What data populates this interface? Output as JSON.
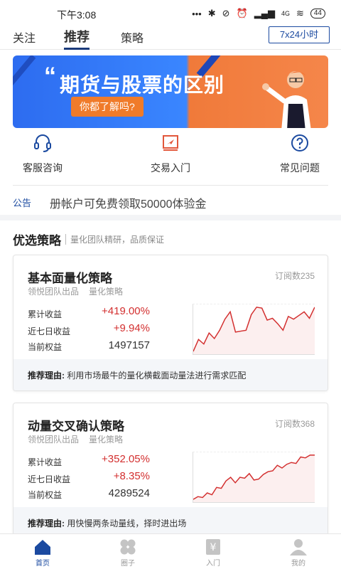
{
  "status_bar": {
    "time": "下午3:08",
    "network": "4G",
    "battery": "44"
  },
  "top_tabs": [
    {
      "label": "关注"
    },
    {
      "label": "推荐"
    },
    {
      "label": "策略"
    }
  ],
  "top_button": "7x24小时",
  "banner": {
    "title": "期货与股票的区别",
    "subtitle": "你都了解吗?"
  },
  "quick_links": [
    {
      "label": "客服咨询",
      "icon": "headset-icon"
    },
    {
      "label": "交易入门",
      "icon": "book-icon"
    },
    {
      "label": "常见问题",
      "icon": "question-icon"
    }
  ],
  "notice": {
    "tag": "公告",
    "text": "册帐户可免费领取50000体验金"
  },
  "section": {
    "title": "优选策略",
    "subtitle": "量化团队精研，品质保证"
  },
  "strategies": [
    {
      "name": "基本面量化策略",
      "subscribers": "订阅数235",
      "source": "领悦团队出品",
      "category": "量化策略",
      "rows": [
        {
          "label": "累计收益",
          "value": "+419.00%"
        },
        {
          "label": "近七日收益",
          "value": "+9.94%"
        },
        {
          "label": "当前权益",
          "value": "1497157"
        }
      ],
      "reason_label": "推荐理由:",
      "reason": "利用市场最牛的量化横截面动量法进行需求匹配",
      "trend": [
        2,
        28,
        18,
        42,
        30,
        48,
        72,
        88,
        44,
        46,
        48,
        82,
        98,
        96,
        70,
        74,
        62,
        48,
        78,
        72,
        80,
        88,
        74,
        98
      ]
    },
    {
      "name": "动量交叉确认策略",
      "subscribers": "订阅数368",
      "source": "领悦团队出品",
      "category": "量化策略",
      "rows": [
        {
          "label": "累计收益",
          "value": "+352.05%"
        },
        {
          "label": "近七日收益",
          "value": "+8.35%"
        },
        {
          "label": "当前权益",
          "value": "4289524"
        }
      ],
      "reason_label": "推荐理由:",
      "reason": "用快慢两条动量线，择时进出场",
      "trend": [
        4,
        10,
        8,
        18,
        14,
        30,
        28,
        44,
        52,
        40,
        52,
        50,
        60,
        46,
        48,
        58,
        64,
        66,
        78,
        72,
        80,
        84,
        82,
        96,
        94,
        100,
        100
      ]
    }
  ],
  "bottom_nav": [
    {
      "label": "首页",
      "icon": "home-icon"
    },
    {
      "label": "圈子",
      "icon": "clover-icon"
    },
    {
      "label": "入门",
      "icon": "yen-book-icon"
    },
    {
      "label": "我的",
      "icon": "user-icon"
    }
  ],
  "colors": {
    "primary": "#1b4aa0",
    "profit": "#d32f2f",
    "banner_blue": "#2d6cf0",
    "banner_orange": "#f07a3a"
  }
}
